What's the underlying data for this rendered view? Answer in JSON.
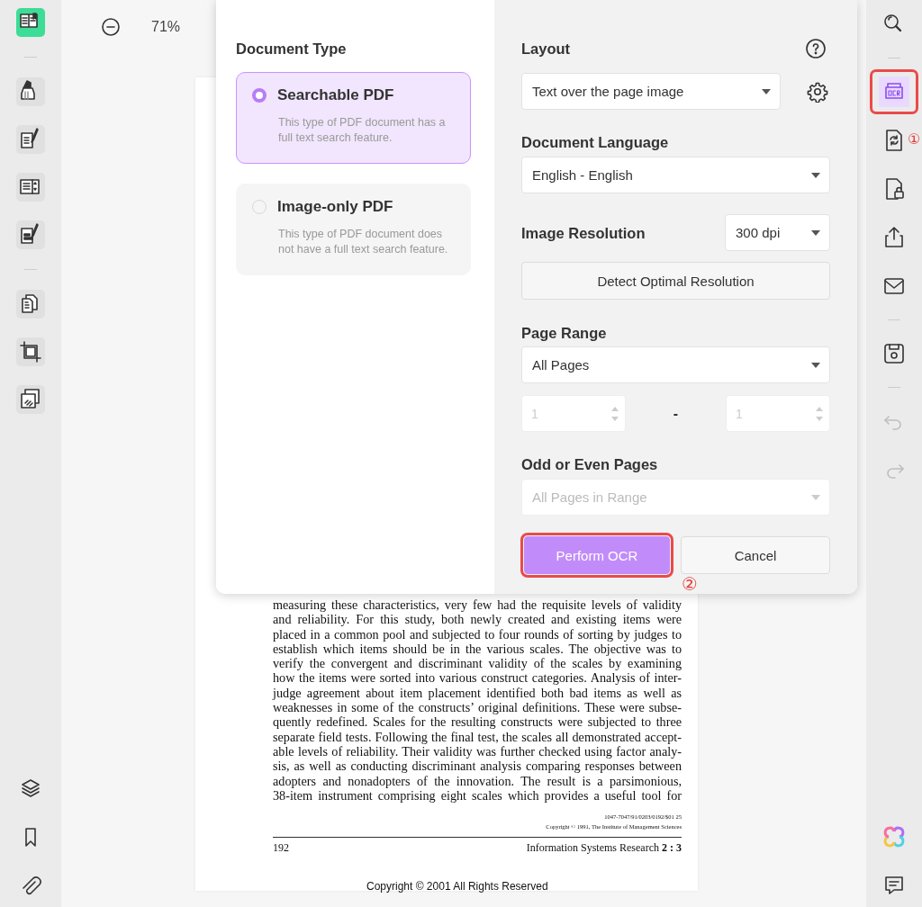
{
  "left_toolbar": {
    "groups": [
      [
        {
          "selected": true
        }
      ],
      [
        {
          "selected": false
        },
        {
          "selected": false
        },
        {
          "selected": false
        },
        {
          "selected": false
        }
      ],
      [
        {
          "selected": false
        },
        {
          "selected": false
        },
        {
          "selected": false
        }
      ]
    ]
  },
  "zoom_bar": {
    "zoom": "71%"
  },
  "page": {
    "body_lines": [
      "measuring these characteristics, very few had the requisite levels of validity",
      "and reliability. For this study, both newly created and existing items were",
      "placed in a common pool and subjected to four rounds of sorting by judges to",
      "establish which items should be in the various scales. The objective was to",
      "verify the convergent and discriminant validity of the scales by examining",
      "how the items were sorted into various construct categories. Analysis of inter-",
      "judge agreement about item placement identified both bad items as well as",
      "weaknesses in some of the constructs’ original definitions. These were subse-",
      "quently redefined. Scales for the resulting constructs were subjected to three",
      "separate field tests. Following the final test, the scales all demonstrated accept-",
      "able levels of reliability. Their validity was further checked using factor analy-",
      "sis, as well as conducting discriminant analysis comparing responses between",
      "adopters and nonadopters of the innovation. The result is a parsimonious,",
      "38-item instrument comprising eight scales which provides a useful tool for"
    ],
    "code": "1047-7047/91/0203/0192/$01 25",
    "copyright": "Copyright © 1991, The Institute of Management Sciences",
    "page_number": "192",
    "journal": "Information Systems Research **2 : 3**",
    "footer": "Copyright © 2001 All Rights Reserved"
  },
  "dialog": {
    "document_type": {
      "title": "Document Type",
      "options": [
        {
          "label": "Searchable PDF",
          "description": "This type of PDF document has a full text search feature.",
          "selected": true
        },
        {
          "label": "Image-only PDF",
          "description": "This type of PDF document does not have a full text search feature.",
          "selected": false
        }
      ]
    },
    "layout": {
      "label": "Layout",
      "value": "Text over the page image"
    },
    "document_language": {
      "label": "Document Language",
      "value": "English - English"
    },
    "image_resolution": {
      "label": "Image Resolution",
      "value": "300 dpi"
    },
    "detect_button": "Detect Optimal Resolution",
    "page_range": {
      "label": "Page Range",
      "value": "All Pages",
      "from": "1",
      "separator": "-",
      "to": "1",
      "disabled": true
    },
    "odd_even": {
      "label": "Odd or Even Pages",
      "value": "All Pages in Range",
      "disabled": true
    },
    "buttons": [
      {
        "label": "Perform OCR",
        "kind": "primary",
        "outlined": true
      },
      {
        "label": "Cancel",
        "kind": "secondary",
        "outlined": false
      }
    ]
  },
  "right_toolbar": {
    "groups": [
      [
        {
          "selected": false,
          "disabled": false,
          "outlined": false
        }
      ],
      [
        {
          "selected": true,
          "disabled": false,
          "outlined": true
        },
        {
          "selected": false,
          "disabled": false,
          "outlined": false
        },
        {
          "selected": false,
          "disabled": false,
          "outlined": false
        },
        {
          "selected": false,
          "disabled": false,
          "outlined": false
        },
        {
          "selected": false,
          "disabled": false,
          "outlined": false
        }
      ],
      [
        {
          "selected": false,
          "disabled": false,
          "outlined": false
        }
      ],
      [
        {
          "selected": false,
          "disabled": true,
          "outlined": false
        },
        {
          "selected": false,
          "disabled": true,
          "outlined": false
        }
      ]
    ]
  },
  "callouts": [
    {
      "number": "①"
    },
    {
      "number": "②"
    }
  ]
}
